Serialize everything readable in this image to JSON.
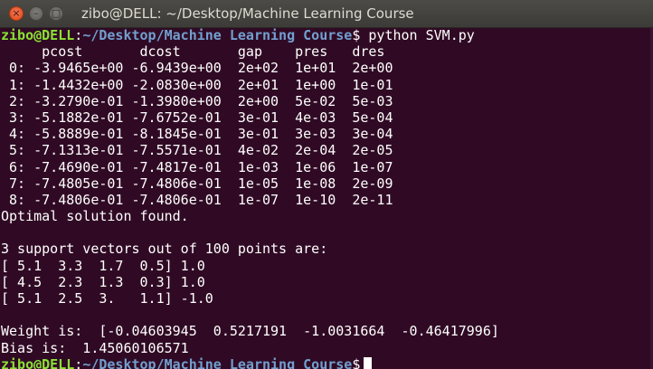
{
  "window": {
    "title": "zibo@DELL: ~/Desktop/Machine Learning Course",
    "close_glyph": "×",
    "minimize_glyph": "–",
    "maximize_glyph": "□"
  },
  "prompt": {
    "user": "zibo@DELL",
    "sep": ":",
    "path": "~/Desktop/Machine Learning Course",
    "dollar": "$",
    "command": " python SVM.py"
  },
  "output_lines": [
    "     pcost       dcost       gap    pres   dres",
    " 0: -3.9465e+00 -6.9439e+00  2e+02  1e+01  2e+00",
    " 1: -1.4432e+00 -2.0830e+00  2e+01  1e+00  1e-01",
    " 2: -3.2790e-01 -1.3980e+00  2e+00  5e-02  5e-03",
    " 3: -5.1882e-01 -7.6752e-01  3e-01  4e-03  5e-04",
    " 4: -5.8889e-01 -8.1845e-01  3e-01  3e-03  3e-04",
    " 5: -7.1313e-01 -7.5571e-01  4e-02  2e-04  2e-05",
    " 6: -7.4690e-01 -7.4817e-01  1e-03  1e-06  1e-07",
    " 7: -7.4805e-01 -7.4806e-01  1e-05  1e-08  2e-09",
    " 8: -7.4806e-01 -7.4806e-01  1e-07  1e-10  2e-11",
    "Optimal solution found.",
    "",
    "3 support vectors out of 100 points are:",
    "[ 5.1  3.3  1.7  0.5] 1.0",
    "[ 4.5  2.3  1.3  0.3] 1.0",
    "[ 5.1  2.5  3.   1.1] -1.0",
    "",
    "Weight is:  [-0.04603945  0.5217191  -1.0031664  -0.46417996]",
    "Bias is:  1.45060106571"
  ],
  "final_prompt": {
    "user": "zibo@DELL",
    "sep": ":",
    "path": "~/Desktop/Machine Learning Course",
    "dollar": "$"
  }
}
